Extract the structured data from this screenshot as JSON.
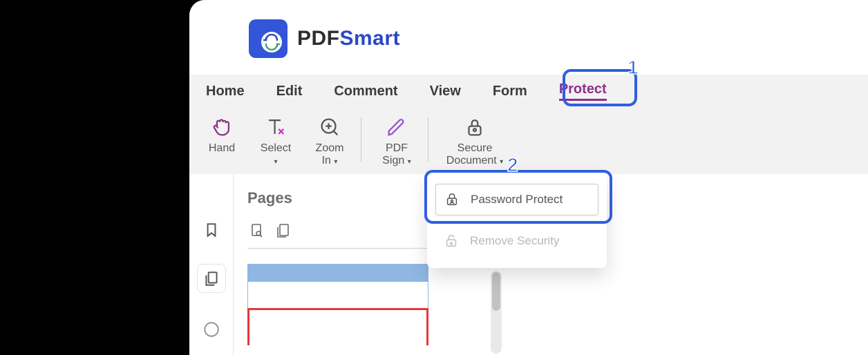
{
  "brand": {
    "bold": "PDF",
    "rest": "Smart"
  },
  "tabs": [
    "Home",
    "Edit",
    "Comment",
    "View",
    "Form",
    "Protect"
  ],
  "active_tab": "Protect",
  "ribbon": {
    "hand": "Hand",
    "select": "Select",
    "zoom_in_1": "Zoom",
    "zoom_in_2": "In",
    "pdf_sign_1": "PDF",
    "pdf_sign_2": "Sign",
    "secure_doc_1": "Secure",
    "secure_doc_2": "Document"
  },
  "pages_panel": {
    "title": "Pages"
  },
  "dropdown": {
    "password_protect": "Password Protect",
    "remove_security": "Remove Security"
  },
  "callouts": {
    "one": "1",
    "two": "2"
  }
}
